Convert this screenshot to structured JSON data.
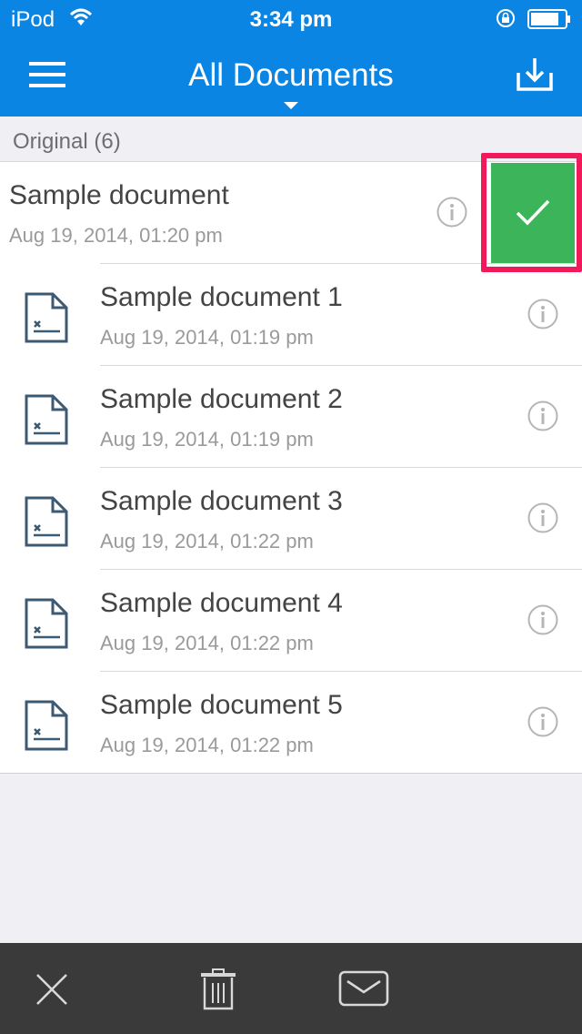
{
  "status": {
    "carrier": "iPod",
    "time": "3:34 pm"
  },
  "header": {
    "title": "All Documents"
  },
  "section": {
    "label": "Original (6)"
  },
  "documents": [
    {
      "title": "Sample document",
      "date": "Aug 19, 2014, 01:20 pm",
      "selected": true
    },
    {
      "title": "Sample document 1",
      "date": "Aug 19, 2014, 01:19 pm"
    },
    {
      "title": "Sample document 2",
      "date": "Aug 19, 2014, 01:19 pm"
    },
    {
      "title": "Sample document 3",
      "date": "Aug 19, 2014, 01:22 pm"
    },
    {
      "title": "Sample document 4",
      "date": "Aug 19, 2014, 01:22 pm"
    },
    {
      "title": "Sample document 5",
      "date": "Aug 19, 2014, 01:22 pm"
    }
  ],
  "icons": {
    "menu": "hamburger-menu-icon",
    "download": "download-tray-icon",
    "info": "info-circle-icon",
    "doc": "document-sign-icon",
    "check": "checkmark-icon",
    "close": "close-x-icon",
    "trash": "trash-icon",
    "mail": "envelope-icon"
  },
  "colors": {
    "accent": "#0a85e3",
    "selected": "#3cb55a",
    "highlight": "#f0195a",
    "toolbar": "#3a3a3a"
  }
}
